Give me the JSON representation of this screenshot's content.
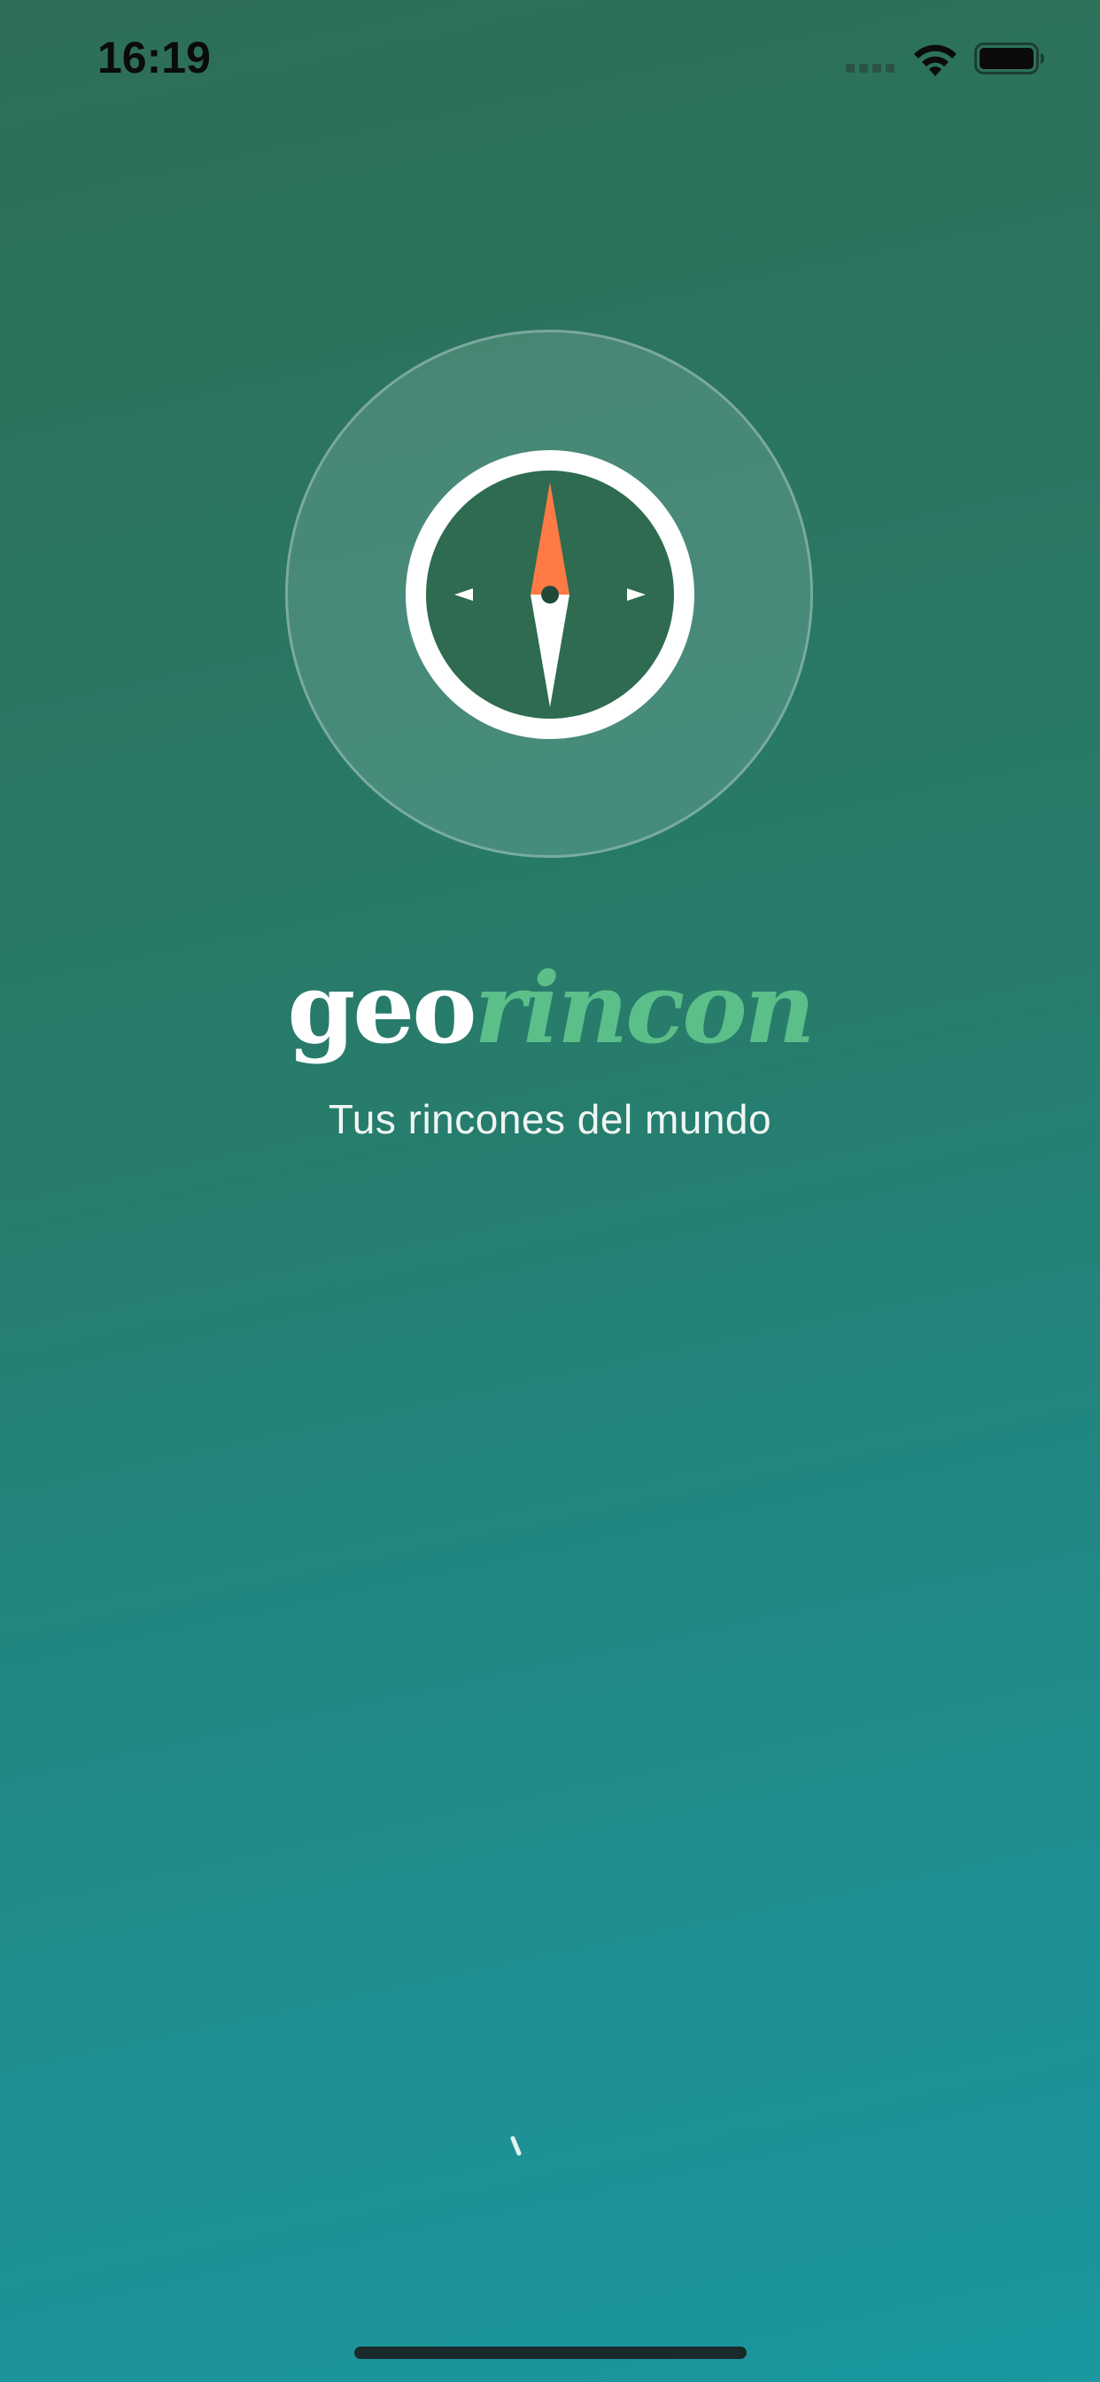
{
  "status_bar": {
    "time": "16:19",
    "signal_icon": "cellular-signal-icon",
    "wifi_icon": "wifi-icon",
    "battery_icon": "battery-icon",
    "battery_level": 1.0
  },
  "logo": {
    "icon": "compass-icon",
    "needle_north_color": "#ff7a45",
    "needle_south_color": "#ffffff",
    "dial_color": "#2e6b50"
  },
  "brand": {
    "part1": "geo",
    "part2": "rincon",
    "part1_color": "#ffffff",
    "part2_color": "#5cbf8a"
  },
  "tagline": "Tus rincones del mundo",
  "loading": {
    "icon": "loading-spinner-icon"
  },
  "colors": {
    "background_top": "#2e6e56",
    "background_bottom": "#1a979f"
  }
}
